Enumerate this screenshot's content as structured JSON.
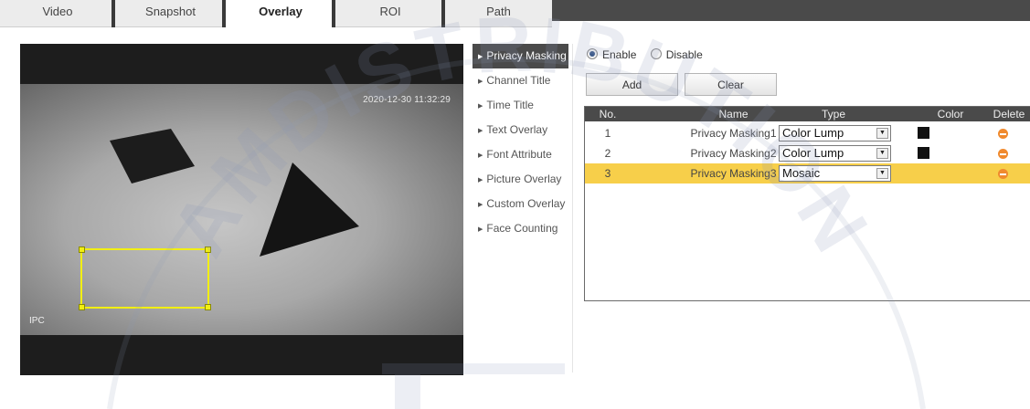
{
  "tabs": [
    {
      "label": "Video",
      "active": false
    },
    {
      "label": "Snapshot",
      "active": false
    },
    {
      "label": "Overlay",
      "active": true
    },
    {
      "label": "ROI",
      "active": false
    },
    {
      "label": "Path",
      "active": false
    }
  ],
  "preview": {
    "timestamp": "2020-12-30 11:32:29",
    "channel_label": "IPC"
  },
  "submenu": [
    {
      "label": "Privacy Masking",
      "active": true
    },
    {
      "label": "Channel Title",
      "active": false
    },
    {
      "label": "Time Title",
      "active": false
    },
    {
      "label": "Text Overlay",
      "active": false
    },
    {
      "label": "Font Attribute",
      "active": false
    },
    {
      "label": "Picture Overlay",
      "active": false
    },
    {
      "label": "Custom Overlay",
      "active": false
    },
    {
      "label": "Face Counting",
      "active": false
    }
  ],
  "mode": {
    "enable_label": "Enable",
    "disable_label": "Disable",
    "selected": "Enable"
  },
  "buttons": {
    "add_label": "Add",
    "clear_label": "Clear"
  },
  "table": {
    "headers": {
      "no": "No.",
      "name": "Name",
      "type": "Type",
      "color": "Color",
      "delete": "Delete"
    },
    "rows": [
      {
        "no": "1",
        "name": "Privacy Masking1",
        "type": "Color Lump",
        "has_color": true,
        "selected": false
      },
      {
        "no": "2",
        "name": "Privacy Masking2",
        "type": "Color Lump",
        "has_color": true,
        "selected": false
      },
      {
        "no": "3",
        "name": "Privacy Masking3",
        "type": "Mosaic",
        "has_color": false,
        "selected": true
      }
    ]
  },
  "watermark": "AMDISTRIBUTION",
  "colors": {
    "tab_bar_dark": "#4a4a4a",
    "submenu_active": "#4a4a4a",
    "selected_row": "#f7cf4a",
    "roi_border": "#f2ef13",
    "delete_icon": "#f08a2e",
    "mask_color": "#111111"
  }
}
